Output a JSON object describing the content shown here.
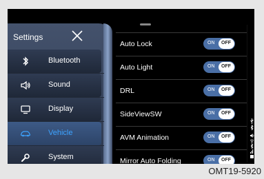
{
  "sidebar": {
    "title": "Settings",
    "items": [
      {
        "label": "Bluetooth",
        "icon": "bluetooth-icon",
        "active": false
      },
      {
        "label": "Sound",
        "icon": "speaker-icon",
        "active": false
      },
      {
        "label": "Display",
        "icon": "monitor-icon",
        "active": false
      },
      {
        "label": "Vehicle",
        "icon": "car-icon",
        "active": true
      },
      {
        "label": "System",
        "icon": "wrench-icon",
        "active": false
      }
    ]
  },
  "settings": [
    {
      "label": "Auto Lock",
      "on": "ON",
      "off": "OFF",
      "state": "off"
    },
    {
      "label": "Auto Light",
      "on": "ON",
      "off": "OFF",
      "state": "off"
    },
    {
      "label": "DRL",
      "on": "ON",
      "off": "OFF",
      "state": "off"
    },
    {
      "label": "SideViewSW",
      "on": "ON",
      "off": "OFF",
      "state": "off"
    },
    {
      "label": "AVM Animation",
      "on": "ON",
      "off": "OFF",
      "state": "off"
    },
    {
      "label": "Mirror Auto Folding",
      "on": "ON",
      "off": "OFF",
      "state": "off"
    }
  ],
  "colors": {
    "accent": "#3da3ff",
    "toggle_on": "#4a6fa6",
    "sidebar": "#2d3950"
  },
  "figure_code": "OMT19-5920"
}
